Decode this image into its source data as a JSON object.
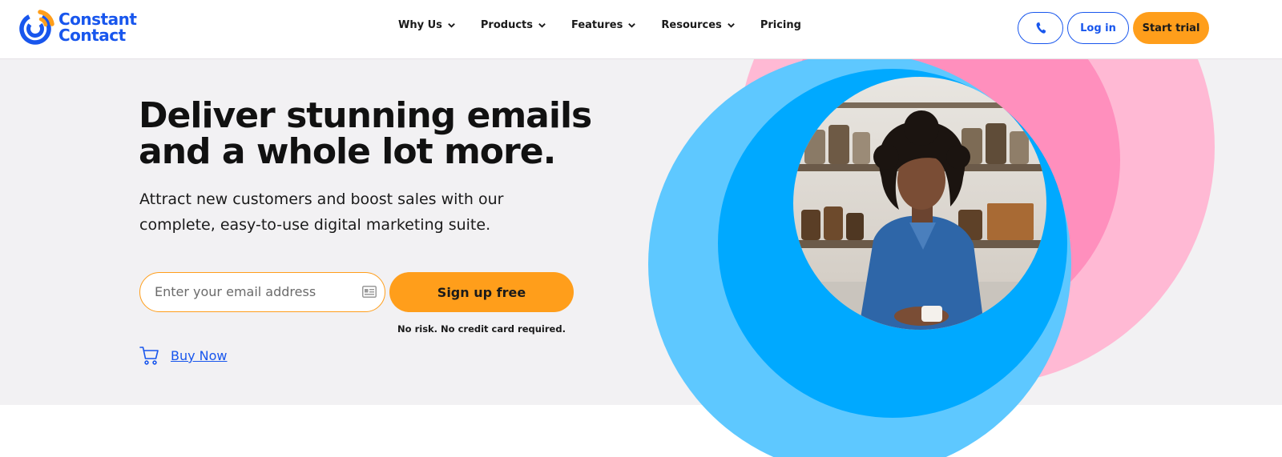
{
  "brand": {
    "name_line1": "Constant",
    "name_line2": "Contact",
    "blue": "#1856ed",
    "orange": "#ff9e1b"
  },
  "nav": {
    "items": [
      {
        "label": "Why Us",
        "has_dropdown": true
      },
      {
        "label": "Products",
        "has_dropdown": true
      },
      {
        "label": "Features",
        "has_dropdown": true
      },
      {
        "label": "Resources",
        "has_dropdown": true
      },
      {
        "label": "Pricing",
        "has_dropdown": false
      }
    ]
  },
  "header_actions": {
    "phone_icon": "phone-icon",
    "login_label": "Log in",
    "trial_label": "Start trial"
  },
  "hero": {
    "headline_line1": "Deliver stunning emails",
    "headline_line2": "and a whole lot more.",
    "subhead_line1": "Attract new customers and boost sales with our",
    "subhead_line2": "complete, easy-to-use digital marketing suite.",
    "email_placeholder": "Enter your email address",
    "signup_label": "Sign up free",
    "disclaimer": "No risk. No credit card required.",
    "buy_now_label": "Buy Now",
    "colors": {
      "background": "#f2f1f3",
      "pink_light": "#ffb9d4",
      "pink": "#ff8fbd",
      "blue_light": "#5ec8ff",
      "blue": "#00a9ff"
    }
  }
}
